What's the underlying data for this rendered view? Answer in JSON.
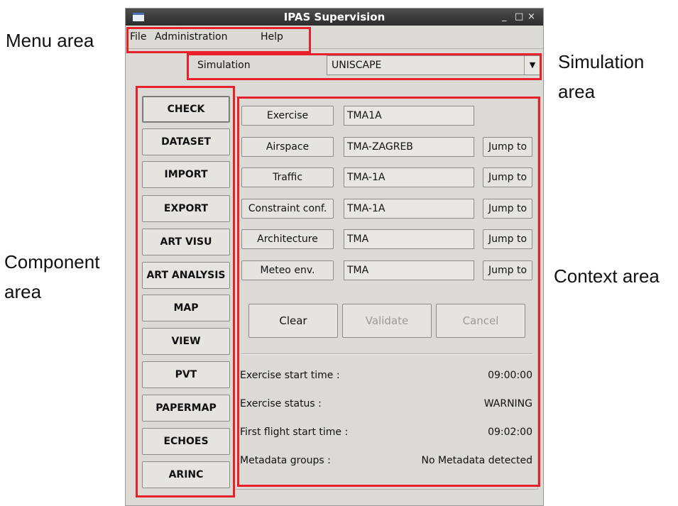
{
  "annotations": {
    "menu_area": "Menu area",
    "simulation_area_line1": "Simulation",
    "simulation_area_line2": "area",
    "component_area_line1": "Component",
    "component_area_line2": "area",
    "context_area": "Context area"
  },
  "window": {
    "title": "IPAS Supervision",
    "controls": [
      "_",
      "□",
      "×"
    ]
  },
  "menu": [
    "File",
    "Administration",
    "Help"
  ],
  "simulation": {
    "label": "Simulation",
    "selected": "UNISCAPE"
  },
  "components": [
    "CHECK",
    "DATASET",
    "IMPORT",
    "EXPORT",
    "ART VISU",
    "ART ANALYSIS",
    "MAP",
    "VIEW",
    "PVT",
    "PAPERMAP",
    "ECHOES",
    "ARINC"
  ],
  "context": {
    "fields": [
      {
        "label": "Exercise",
        "value": "TMA1A",
        "jump": ""
      },
      {
        "label": "Airspace",
        "value": "TMA-ZAGREB",
        "jump": "Jump to"
      },
      {
        "label": "Traffic",
        "value": "TMA-1A",
        "jump": "Jump to"
      },
      {
        "label": "Constraint conf.",
        "value": "TMA-1A",
        "jump": "Jump to"
      },
      {
        "label": "Architecture",
        "value": "TMA",
        "jump": "Jump to"
      },
      {
        "label": "Meteo env.",
        "value": "TMA",
        "jump": "Jump to"
      }
    ],
    "actions": {
      "clear": "Clear",
      "validate": "Validate",
      "cancel": "Cancel"
    },
    "info": [
      {
        "label": "Exercise start time :",
        "value": "09:00:00"
      },
      {
        "label": "Exercise status :",
        "value": "WARNING"
      },
      {
        "label": "First flight start time :",
        "value": "09:02:00"
      },
      {
        "label": "Metadata groups :",
        "value": "No Metadata detected"
      }
    ]
  },
  "colors": {
    "highlight": "#e8202a",
    "window_bg": "#dcdad5",
    "titlebar": "#3a3a3a"
  }
}
